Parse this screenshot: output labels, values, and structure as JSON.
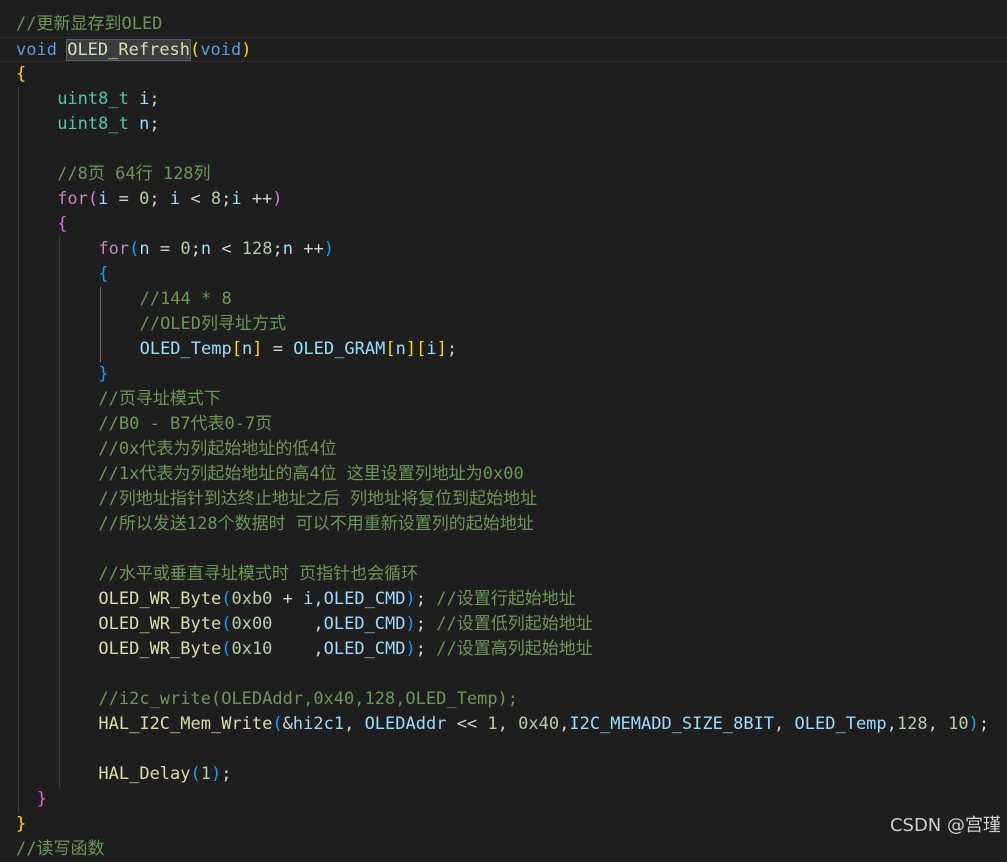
{
  "watermark": "CSDN @宫瑾",
  "lines": [
    {
      "indent": 0,
      "tokens": [
        [
          "c",
          "//更新显存到OLED"
        ]
      ]
    },
    {
      "indent": 0,
      "current": true,
      "tokens": [
        [
          "k",
          "void"
        ],
        [
          "p",
          " "
        ],
        [
          "f sel",
          "OLED_Refresh"
        ],
        [
          "b1",
          "("
        ],
        [
          "k",
          "void"
        ],
        [
          "b1",
          ")"
        ]
      ]
    },
    {
      "indent": 0,
      "tokens": [
        [
          "b1",
          "{"
        ]
      ]
    },
    {
      "indent": 4,
      "tokens": [
        [
          "t",
          "uint8_t"
        ],
        [
          "p",
          " "
        ],
        [
          "v",
          "i"
        ],
        [
          "p",
          ";"
        ]
      ]
    },
    {
      "indent": 4,
      "tokens": [
        [
          "t",
          "uint8_t"
        ],
        [
          "p",
          " "
        ],
        [
          "v",
          "n"
        ],
        [
          "p",
          ";"
        ]
      ]
    },
    {
      "indent": 0,
      "tokens": []
    },
    {
      "indent": 4,
      "tokens": [
        [
          "c",
          "//8页 64行 128列"
        ]
      ]
    },
    {
      "indent": 4,
      "tokens": [
        [
          "kw",
          "for"
        ],
        [
          "b2",
          "("
        ],
        [
          "v",
          "i"
        ],
        [
          "o",
          " = "
        ],
        [
          "n",
          "0"
        ],
        [
          "p",
          "; "
        ],
        [
          "v",
          "i"
        ],
        [
          "o",
          " < "
        ],
        [
          "n",
          "8"
        ],
        [
          "p",
          ";"
        ],
        [
          "v",
          "i"
        ],
        [
          "o",
          " ++"
        ],
        [
          "b2",
          ")"
        ]
      ]
    },
    {
      "indent": 4,
      "tokens": [
        [
          "b2",
          "{"
        ]
      ]
    },
    {
      "indent": 8,
      "tokens": [
        [
          "kw",
          "for"
        ],
        [
          "b3",
          "("
        ],
        [
          "v",
          "n"
        ],
        [
          "o",
          " = "
        ],
        [
          "n",
          "0"
        ],
        [
          "p",
          ";"
        ],
        [
          "v",
          "n"
        ],
        [
          "o",
          " < "
        ],
        [
          "n",
          "128"
        ],
        [
          "p",
          ";"
        ],
        [
          "v",
          "n"
        ],
        [
          "o",
          " ++"
        ],
        [
          "b3",
          ")"
        ]
      ]
    },
    {
      "indent": 8,
      "tokens": [
        [
          "b3",
          "{"
        ]
      ]
    },
    {
      "indent": 12,
      "tokens": [
        [
          "c",
          "//144 * 8"
        ]
      ]
    },
    {
      "indent": 12,
      "tokens": [
        [
          "c",
          "//OLED列寻址方式"
        ]
      ]
    },
    {
      "indent": 12,
      "tokens": [
        [
          "v",
          "OLED_Temp"
        ],
        [
          "b1",
          "["
        ],
        [
          "v",
          "n"
        ],
        [
          "b1",
          "]"
        ],
        [
          "o",
          " = "
        ],
        [
          "v",
          "OLED_GRAM"
        ],
        [
          "b1",
          "["
        ],
        [
          "v",
          "n"
        ],
        [
          "b1",
          "]"
        ],
        [
          "b1",
          "["
        ],
        [
          "v",
          "i"
        ],
        [
          "b1",
          "]"
        ],
        [
          "p",
          ";"
        ]
      ]
    },
    {
      "indent": 8,
      "tokens": [
        [
          "b3",
          "}"
        ]
      ]
    },
    {
      "indent": 8,
      "tokens": [
        [
          "c",
          "//页寻址模式下"
        ]
      ]
    },
    {
      "indent": 8,
      "tokens": [
        [
          "c",
          "//B0 - B7代表0-7页"
        ]
      ]
    },
    {
      "indent": 8,
      "tokens": [
        [
          "c",
          "//0x代表为列起始地址的低4位"
        ]
      ]
    },
    {
      "indent": 8,
      "tokens": [
        [
          "c",
          "//1x代表为列起始地址的高4位 这里设置列地址为0x00"
        ]
      ]
    },
    {
      "indent": 8,
      "tokens": [
        [
          "c",
          "//列地址指针到达终止地址之后 列地址将复位到起始地址"
        ]
      ]
    },
    {
      "indent": 8,
      "tokens": [
        [
          "c",
          "//所以发送128个数据时 可以不用重新设置列的起始地址"
        ]
      ]
    },
    {
      "indent": 0,
      "tokens": []
    },
    {
      "indent": 8,
      "tokens": [
        [
          "c",
          "//水平或垂直寻址模式时 页指针也会循环"
        ]
      ]
    },
    {
      "indent": 8,
      "tokens": [
        [
          "f",
          "OLED_WR_Byte"
        ],
        [
          "b3",
          "("
        ],
        [
          "n",
          "0xb0"
        ],
        [
          "o",
          " + "
        ],
        [
          "v",
          "i"
        ],
        [
          "p",
          ","
        ],
        [
          "v",
          "OLED_CMD"
        ],
        [
          "b3",
          ")"
        ],
        [
          "p",
          "; "
        ],
        [
          "c",
          "//设置行起始地址"
        ]
      ]
    },
    {
      "indent": 8,
      "tokens": [
        [
          "f",
          "OLED_WR_Byte"
        ],
        [
          "b3",
          "("
        ],
        [
          "n",
          "0x00"
        ],
        [
          "p",
          "    ,"
        ],
        [
          "v",
          "OLED_CMD"
        ],
        [
          "b3",
          ")"
        ],
        [
          "p",
          "; "
        ],
        [
          "c",
          "//设置低列起始地址"
        ]
      ]
    },
    {
      "indent": 8,
      "tokens": [
        [
          "f",
          "OLED_WR_Byte"
        ],
        [
          "b3",
          "("
        ],
        [
          "n",
          "0x10"
        ],
        [
          "p",
          "    ,"
        ],
        [
          "v",
          "OLED_CMD"
        ],
        [
          "b3",
          ")"
        ],
        [
          "p",
          "; "
        ],
        [
          "c",
          "//设置高列起始地址"
        ]
      ]
    },
    {
      "indent": 0,
      "tokens": []
    },
    {
      "indent": 8,
      "tokens": [
        [
          "c",
          "//i2c_write(OLEDAddr,0x40,128,OLED_Temp);"
        ]
      ]
    },
    {
      "indent": 8,
      "tokens": [
        [
          "f",
          "HAL_I2C_Mem_Write"
        ],
        [
          "b3",
          "("
        ],
        [
          "o",
          "&"
        ],
        [
          "v",
          "hi2c1"
        ],
        [
          "p",
          ", "
        ],
        [
          "v",
          "OLEDAddr"
        ],
        [
          "o",
          " << "
        ],
        [
          "n",
          "1"
        ],
        [
          "p",
          ", "
        ],
        [
          "n",
          "0x40"
        ],
        [
          "p",
          ","
        ],
        [
          "v",
          "I2C_MEMADD_SIZE_8BIT"
        ],
        [
          "p",
          ", "
        ],
        [
          "v",
          "OLED_Temp"
        ],
        [
          "p",
          ","
        ],
        [
          "n",
          "128"
        ],
        [
          "p",
          ", "
        ],
        [
          "n",
          "10"
        ],
        [
          "b3",
          ")"
        ],
        [
          "p",
          ";"
        ]
      ]
    },
    {
      "indent": 0,
      "tokens": []
    },
    {
      "indent": 8,
      "tokens": [
        [
          "f",
          "HAL_Delay"
        ],
        [
          "b3",
          "("
        ],
        [
          "n",
          "1"
        ],
        [
          "b3",
          ")"
        ],
        [
          "p",
          ";"
        ]
      ]
    },
    {
      "indent": 2,
      "tokens": [
        [
          "b2",
          "}"
        ]
      ]
    },
    {
      "indent": 0,
      "tokens": [
        [
          "b1",
          "}"
        ]
      ]
    },
    {
      "indent": 0,
      "tokens": [
        [
          "c",
          "//读写函数"
        ]
      ]
    }
  ]
}
